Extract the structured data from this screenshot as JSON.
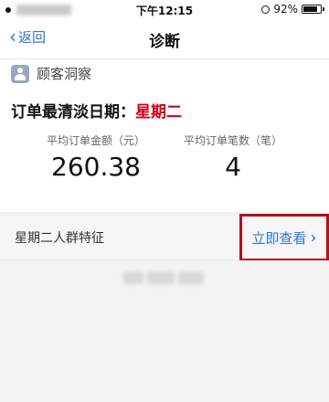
{
  "status_bar": {
    "time": "下午12:15",
    "battery": "92%"
  },
  "nav": {
    "back_label": "返回",
    "title": "诊断"
  },
  "insight": {
    "section_label": "顾客洞察",
    "headline_prefix": "订单最清淡日期：",
    "headline_day": "星期二",
    "stats": [
      {
        "caption": "平均订单金额（元）",
        "value": "260.38"
      },
      {
        "caption": "平均订单笔数（笔）",
        "value": "4"
      }
    ]
  },
  "crowd": {
    "title": "星期二人群特征",
    "view_label": "立即查看"
  },
  "colors": {
    "accent_blue": "#2e73d9",
    "highlight_red": "#d0021b",
    "box_red": "#b0121b"
  }
}
